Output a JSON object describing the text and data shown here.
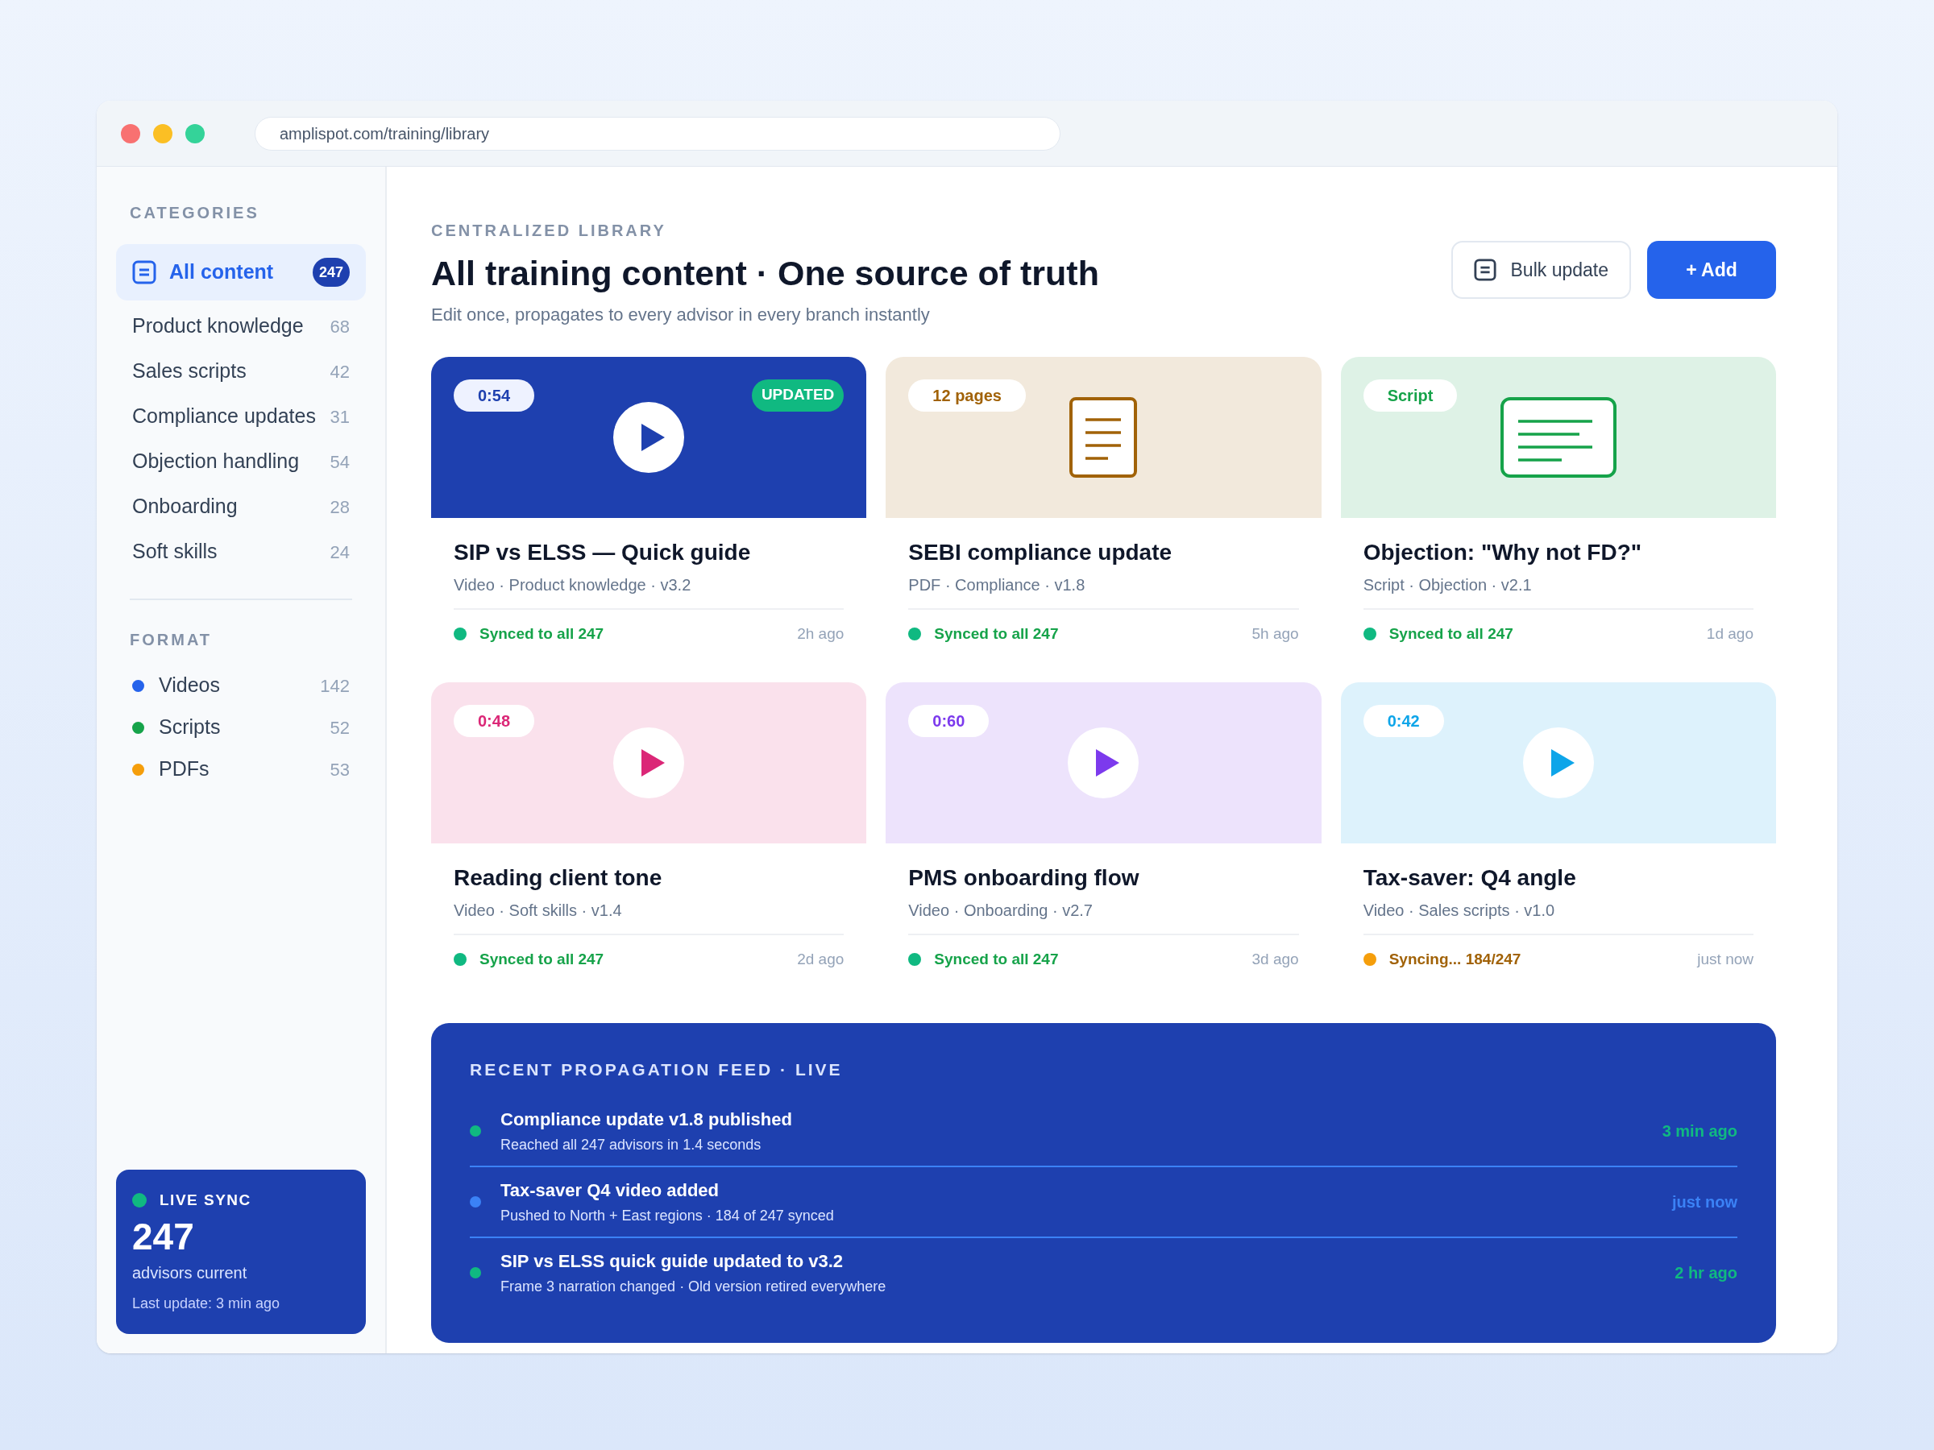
{
  "browser": {
    "url": "amplispot.com/training/library"
  },
  "sidebar": {
    "categories_heading": "CATEGORIES",
    "categories": [
      {
        "label": "All content",
        "count": "247",
        "selected": true
      },
      {
        "label": "Product knowledge",
        "count": "68",
        "selected": false
      },
      {
        "label": "Sales scripts",
        "count": "42",
        "selected": false
      },
      {
        "label": "Compliance updates",
        "count": "31",
        "selected": false
      },
      {
        "label": "Objection handling",
        "count": "54",
        "selected": false
      },
      {
        "label": "Onboarding",
        "count": "28",
        "selected": false
      },
      {
        "label": "Soft skills",
        "count": "24",
        "selected": false
      }
    ],
    "format_heading": "FORMAT",
    "formats": [
      {
        "label": "Videos",
        "count": "142",
        "color": "#2563eb"
      },
      {
        "label": "Scripts",
        "count": "52",
        "color": "#16a34a"
      },
      {
        "label": "PDFs",
        "count": "53",
        "color": "#f59e0b"
      }
    ],
    "live_sync": {
      "label": "LIVE SYNC",
      "number": "247",
      "caption": "advisors current",
      "updated": "Last update: 3 min ago"
    }
  },
  "header": {
    "eyebrow": "CENTRALIZED LIBRARY",
    "title": "All training content · One source of truth",
    "subtitle": "Edit once, propagates to every advisor in every branch instantly",
    "buttons": [
      {
        "label": "Bulk update",
        "kind": "secondary"
      },
      {
        "label": "+ Add",
        "kind": "primary"
      }
    ]
  },
  "cards": [
    {
      "kind": "video",
      "color": "#1e40af",
      "highlighted": true,
      "tag": "0:54",
      "badge": "UPDATED",
      "title": "SIP vs ELSS — Quick guide",
      "meta": "Video · Product knowledge · v3.2",
      "synced": true,
      "status_text": "Synced to all 247",
      "time": "2h ago"
    },
    {
      "kind": "pdf",
      "color": "#a16207",
      "highlighted": false,
      "tag": "12 pages",
      "title": "SEBI compliance update",
      "meta": "PDF · Compliance · v1.8",
      "synced": true,
      "status_text": "Synced to all 247",
      "time": "5h ago"
    },
    {
      "kind": "script",
      "color": "#16a34a",
      "highlighted": false,
      "tag": "Script",
      "title": "Objection: \"Why not FD?\"",
      "meta": "Script · Objection · v2.1",
      "synced": true,
      "status_text": "Synced to all 247",
      "time": "1d ago"
    },
    {
      "kind": "video",
      "color": "#db2777",
      "highlighted": false,
      "tag": "0:48",
      "title": "Reading client tone",
      "meta": "Video · Soft skills · v1.4",
      "synced": true,
      "status_text": "Synced to all 247",
      "time": "2d ago"
    },
    {
      "kind": "video",
      "color": "#7c3aed",
      "highlighted": false,
      "tag": "0:60",
      "title": "PMS onboarding flow",
      "meta": "Video · Onboarding · v2.7",
      "synced": true,
      "status_text": "Synced to all 247",
      "time": "3d ago"
    },
    {
      "kind": "video",
      "color": "#0ea5e9",
      "highlighted": false,
      "tag": "0:42",
      "title": "Tax-saver: Q4 angle",
      "meta": "Video · Sales scripts · v1.0",
      "synced": false,
      "status_text": "Syncing... 184/247",
      "time": "just now"
    }
  ],
  "feed": {
    "heading": "RECENT PROPAGATION FEED · LIVE",
    "items": [
      {
        "title": "Compliance update v1.8 published",
        "detail": "Reached all 247 advisors in 1.4 seconds",
        "time": "3 min ago",
        "color": "#10b981"
      },
      {
        "title": "Tax-saver Q4 video added",
        "detail": "Pushed to North + East regions · 184 of 247 synced",
        "time": "just now",
        "color": "#3b82f6"
      },
      {
        "title": "SIP vs ELSS quick guide updated to v3.2",
        "detail": "Frame 3 narration changed · Old version retired everywhere",
        "time": "2 hr ago",
        "color": "#10b981"
      }
    ]
  }
}
